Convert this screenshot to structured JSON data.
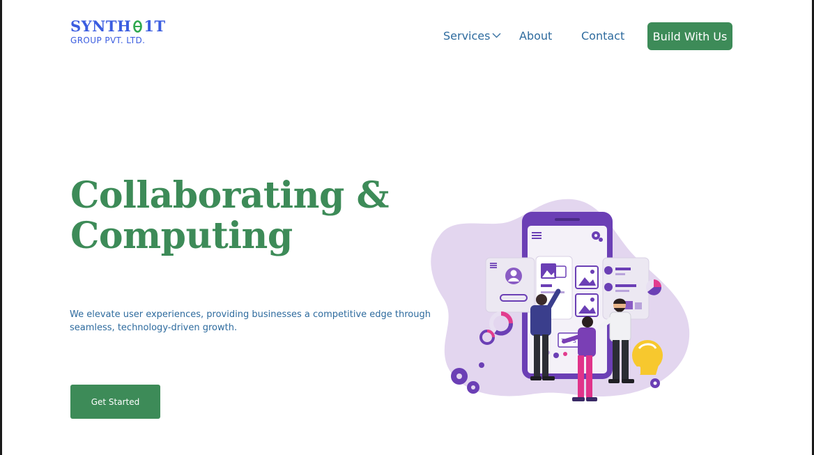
{
  "brand": {
    "name_left": "SYNTH",
    "name_right": "1T",
    "subtitle": "GROUP PVT. LTD."
  },
  "nav": {
    "items": [
      {
        "label": "Services",
        "has_dropdown": true
      },
      {
        "label": "About"
      },
      {
        "label": "Contact"
      }
    ],
    "cta_label": "Build With Us"
  },
  "hero": {
    "title_line1": "Collaborating &",
    "title_line2": "Computing",
    "description": "We elevate user experiences, providing businesses a competitive edge through seamless, technology-driven growth.",
    "button_label": "Get Started"
  },
  "colors": {
    "brand_blue": "#3b5de0",
    "primary_green": "#3d8b58",
    "nav_text": "#2e6b9e",
    "illustration_purple": "#6b3fb5",
    "blob_lavender": "#e3d6ef"
  },
  "illustration": {
    "icon": "team-collaborating-on-phone-illustration",
    "phone_status": "T = S"
  }
}
